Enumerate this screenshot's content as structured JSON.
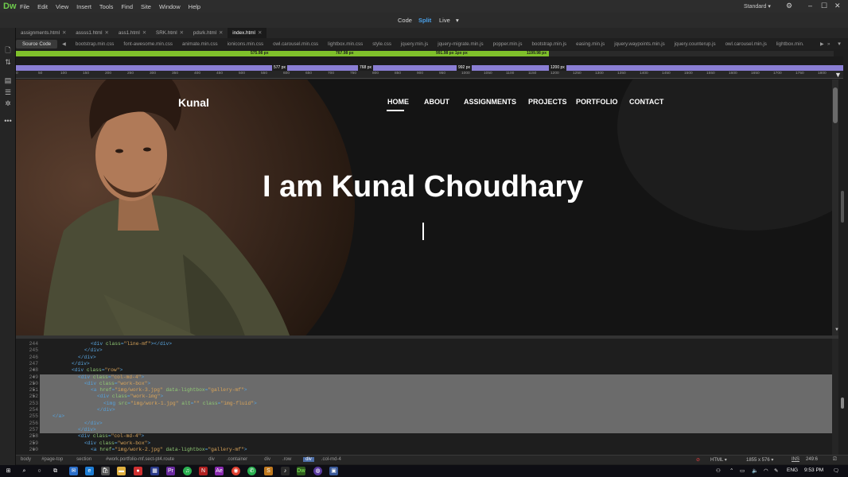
{
  "app": {
    "logo": "Dw",
    "menu": [
      "File",
      "Edit",
      "View",
      "Insert",
      "Tools",
      "Find",
      "Site",
      "Window",
      "Help"
    ],
    "workspace": "Standard",
    "workspace_caret": "▾",
    "views": {
      "code": "Code",
      "split": "Split",
      "live": "Live"
    }
  },
  "doc_tabs": [
    {
      "label": "assignments.html",
      "active": false
    },
    {
      "label": "assss1.html",
      "active": false
    },
    {
      "label": "ass1.html",
      "active": false
    },
    {
      "label": "SRK.html",
      "active": false
    },
    {
      "label": "pdsrk.html",
      "active": false
    },
    {
      "label": "index.html",
      "active": true
    }
  ],
  "related_files": {
    "source": "Source Code",
    "files": [
      "bootstrap.min.css",
      "font-awesome.min.css",
      "animate.min.css",
      "ionicons.min.css",
      "owl.carousel.min.css",
      "lightbox.min.css",
      "style.css",
      "jquery.min.js",
      "jquery-migrate.min.js",
      "popper.min.js",
      "bootstrap.min.js",
      "easing.min.js",
      "jquery.waypoints.min.js",
      "jquery.counterup.js",
      "owl.carousel.min.js",
      "lightbox.min."
    ]
  },
  "media_queries": {
    "green": [
      "575.98 px",
      "767.98 px",
      "991.98 px 1px px",
      "1199.98 px"
    ],
    "purple": [
      "577 px",
      "768 px",
      "992 px",
      "1200 px"
    ]
  },
  "ruler": [
    "0",
    "50",
    "100",
    "150",
    "200",
    "250",
    "300",
    "350",
    "400",
    "450",
    "500",
    "550",
    "600",
    "650",
    "700",
    "750",
    "800",
    "850",
    "900",
    "950",
    "1000",
    "1050",
    "1100",
    "1150",
    "1200",
    "1250",
    "1300",
    "1350",
    "1400",
    "1450",
    "1500",
    "1550",
    "1600",
    "1650",
    "1700",
    "1750",
    "1800"
  ],
  "site": {
    "logo": "Kunal",
    "nav": [
      "HOME",
      "ABOUT",
      "ASSIGNMENTS",
      "PROJECTS",
      "PORTFOLIO",
      "CONTACT"
    ],
    "hero": "I am Kunal Choudhary"
  },
  "code_lines": [
    {
      "n": "244",
      "fold": "",
      "indent": 8,
      "html": "<div class=\"line-mf\"></div>",
      "sel": false
    },
    {
      "n": "245",
      "fold": "",
      "indent": 6,
      "html": "</div>",
      "sel": false
    },
    {
      "n": "246",
      "fold": "",
      "indent": 4,
      "html": "</div>",
      "sel": false
    },
    {
      "n": "247",
      "fold": "",
      "indent": 2,
      "html": "</div>",
      "sel": false
    },
    {
      "n": "248",
      "fold": "▼",
      "indent": 2,
      "html": "<div class=\"row\">",
      "sel": false
    },
    {
      "n": "249",
      "fold": "▼",
      "indent": 4,
      "html": "<div class=\"col-md-4\">",
      "sel": true
    },
    {
      "n": "250",
      "fold": "▼",
      "indent": 6,
      "html": "<div class=\"work-box\">",
      "sel": true
    },
    {
      "n": "251",
      "fold": "▼",
      "indent": 8,
      "html": "<a href=\"img/work-3.jpg\" data-lightbox=\"gallery-mf\">",
      "sel": true
    },
    {
      "n": "252",
      "fold": "▼",
      "indent": 10,
      "html": "<div class=\"work-img\">",
      "sel": true
    },
    {
      "n": "253",
      "fold": "",
      "indent": 12,
      "html": "<img src=\"img/work-1.jpg\" alt=\"\" class=\"img-fluid\">",
      "sel": true
    },
    {
      "n": "254",
      "fold": "",
      "indent": 10,
      "html": "</div>",
      "sel": true
    },
    {
      "n": "255",
      "fold": "",
      "indent": -4,
      "html": "</a>",
      "sel": true
    },
    {
      "n": "256",
      "fold": "",
      "indent": 6,
      "html": "</div>",
      "sel": true
    },
    {
      "n": "257",
      "fold": "",
      "indent": 4,
      "html": "</div>",
      "sel": true
    },
    {
      "n": "258",
      "fold": "▼",
      "indent": 4,
      "html": "<div class=\"col-md-4\">",
      "sel": false
    },
    {
      "n": "259",
      "fold": "▼",
      "indent": 6,
      "html": "<div class=\"work-box\">",
      "sel": false
    },
    {
      "n": "260",
      "fold": "▼",
      "indent": 8,
      "html": "<a href=\"img/work-2.jpg\" data-lightbox=\"gallery-mf\">",
      "sel": false
    }
  ],
  "status": {
    "crumbs": [
      "body",
      "#page-top",
      "section",
      "#work.portfolio-mf.sect-pt4.route",
      "div",
      ".container",
      "div",
      ".row",
      "div",
      ".col-md-4"
    ],
    "lang": "HTML",
    "size": "1855 x 576",
    "ins": "INS",
    "pos": "249:6"
  },
  "taskbar": {
    "lang": "ENG",
    "time": "9:53 PM"
  },
  "colors": {
    "accent_green": "#7fc02b",
    "accent_purple": "#8a7ed4",
    "split_blue": "#4aa0e8"
  }
}
